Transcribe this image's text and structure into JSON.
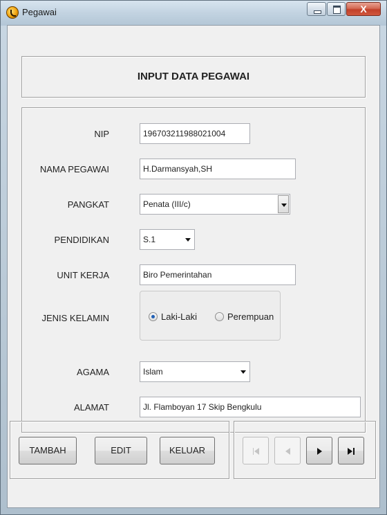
{
  "window": {
    "title": "Pegawai",
    "close_label": "X"
  },
  "header": {
    "caption": "INPUT DATA PEGAWAI"
  },
  "form": {
    "nip": {
      "label": "NIP",
      "value": "196703211988021004"
    },
    "nama": {
      "label": "NAMA PEGAWAI",
      "value": "H.Darmansyah,SH"
    },
    "pangkat": {
      "label": "PANGKAT",
      "value": "Penata (III/c)"
    },
    "pendidikan": {
      "label": "PENDIDIKAN",
      "value": "S.1"
    },
    "unit_kerja": {
      "label": "UNIT KERJA",
      "value": "Biro Pemerintahan"
    },
    "jenis_kelamin": {
      "label": "JENIS KELAMIN",
      "options": [
        "Laki-Laki",
        "Perempuan"
      ],
      "selected": "Laki-Laki"
    },
    "agama": {
      "label": "AGAMA",
      "value": "Islam"
    },
    "alamat": {
      "label": "ALAMAT",
      "value": "Jl. Flamboyan 17 Skip Bengkulu"
    }
  },
  "actions": {
    "tambah": "TAMBAH",
    "edit": "EDIT",
    "keluar": "KELUAR"
  },
  "navigation": {
    "first": {
      "icon": "first-record-icon",
      "enabled": false
    },
    "prev": {
      "icon": "previous-record-icon",
      "enabled": false
    },
    "next": {
      "icon": "next-record-icon",
      "enabled": true
    },
    "last": {
      "icon": "last-record-icon",
      "enabled": true
    }
  },
  "colors": {
    "radio_selected": "#1f5fb5",
    "close_button": "#c2412a"
  }
}
